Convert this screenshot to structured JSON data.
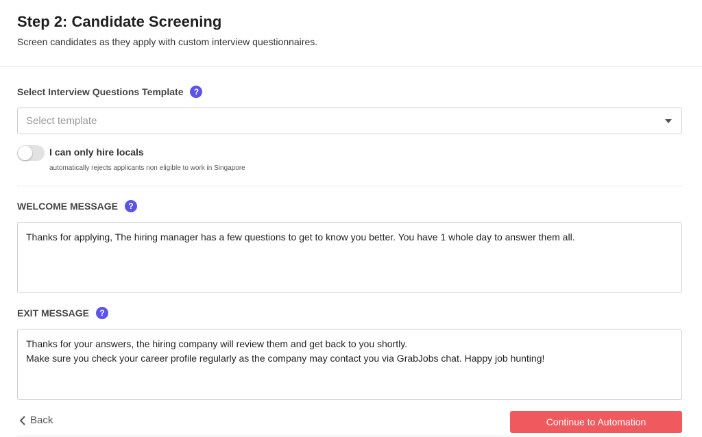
{
  "header": {
    "title": "Step 2: Candidate Screening",
    "subtitle": "Screen candidates as they apply with custom interview questionnaires."
  },
  "template": {
    "label": "Select Interview Questions Template",
    "placeholder": "Select template"
  },
  "locals_toggle": {
    "label": "I can only hire locals",
    "hint": "automatically rejects applicants non eligible to work in Singapore",
    "enabled": false
  },
  "welcome": {
    "label": "WELCOME MESSAGE",
    "text": "Thanks for applying, The hiring manager has a few questions to get to know you better. You have 1 whole day to answer them all."
  },
  "exit": {
    "label": "EXIT MESSAGE",
    "line1": "Thanks for your answers, the hiring company will review them and get back to you shortly.",
    "line2": "Make sure you check your career profile regularly as the company may contact you via GrabJobs chat. Happy job hunting!"
  },
  "help_glyph": "?",
  "footer": {
    "back_label": "Back",
    "continue_label": "Continue to Automation"
  },
  "colors": {
    "accent": "#5b54e8",
    "primary_button": "#f05a5f"
  }
}
